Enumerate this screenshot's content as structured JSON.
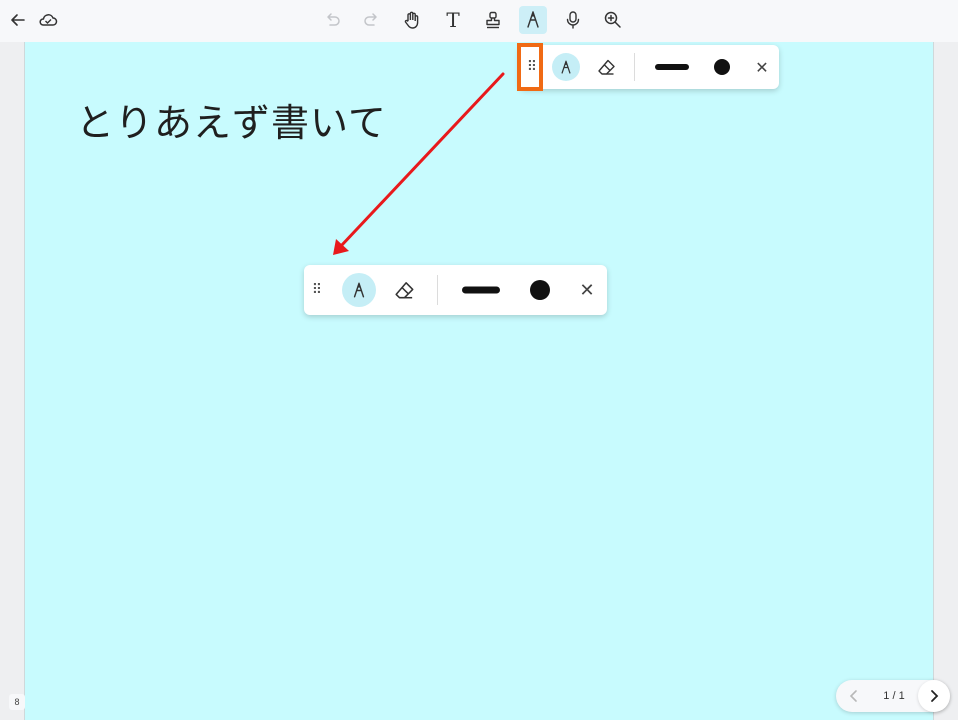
{
  "topbar": {
    "left_icons": [
      "back-arrow-icon",
      "cloud-sync-icon"
    ],
    "tools": [
      "undo-icon",
      "redo-icon",
      "hand-icon",
      "text-icon",
      "stamp-icon",
      "pen-icon",
      "microphone-icon",
      "zoom-in-icon"
    ],
    "active_tool": "pen-icon",
    "text_tool_glyph": "T"
  },
  "canvas": {
    "background": "#c8fbfe",
    "handwritten_text": "とりあえず書いて"
  },
  "pen_toolbar": {
    "grip_glyph": "⠿",
    "close_glyph": "✕",
    "stroke_color": "#111111",
    "active_tool": "pen"
  },
  "annotation": {
    "highlight_color": "#f06a14",
    "arrow_color": "#e8191c"
  },
  "footer": {
    "page_indicator": "8",
    "pager_label": "1 / 1"
  }
}
